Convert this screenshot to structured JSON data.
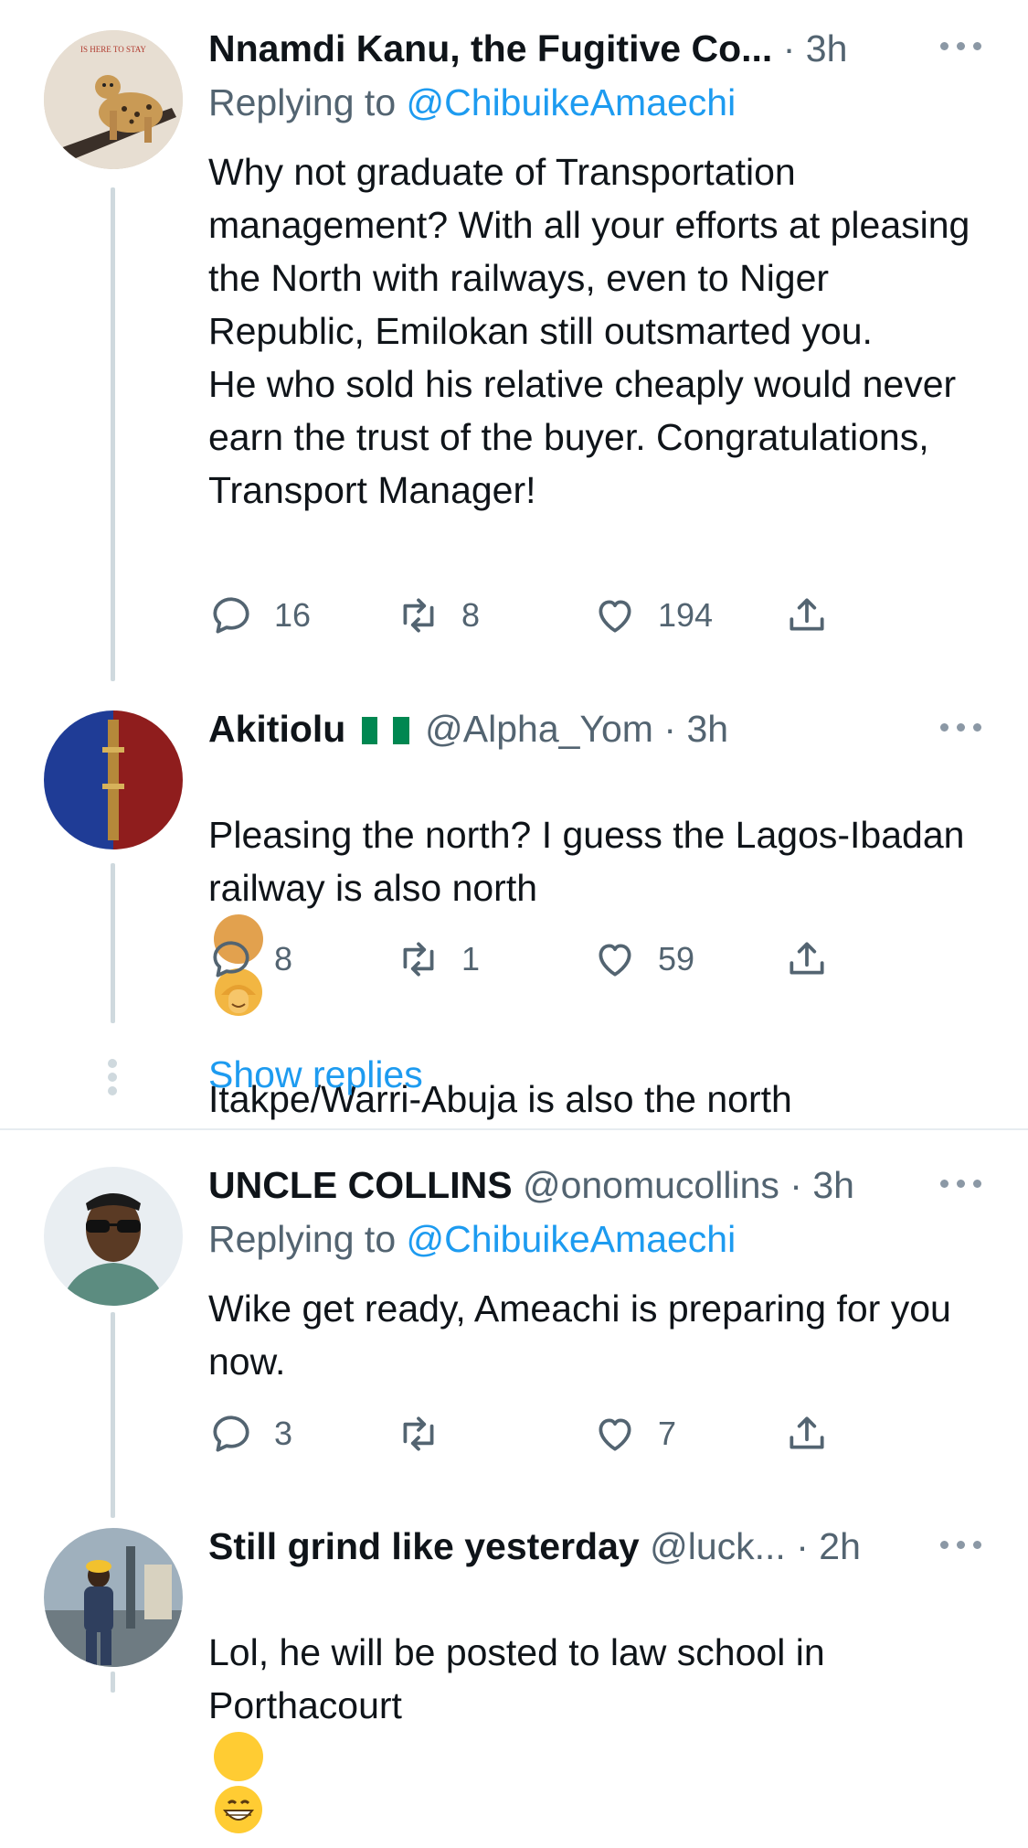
{
  "tweets": [
    {
      "name": "Nnamdi Kanu, the Fugitive Co...",
      "time": "3h",
      "replying_prefix": "Replying to",
      "replying_to": "@ChibuikeAmaechi",
      "avatar_icon": "cheetah-avatar",
      "avatar_text": "IS HERE TO STAY",
      "text": "Why not graduate of Transportation management? With all your efforts at pleasing the North with railways, even to Niger Republic,  Emilokan still outsmarted you.\nHe who sold his relative cheaply would never earn the trust of the buyer. Congratulations, Transport Manager!",
      "replies": "16",
      "retweets": "8",
      "likes": "194"
    },
    {
      "name": "Akitiolu",
      "flag_icon": "nigeria-flag-icon",
      "handle": "@Alpha_Yom",
      "time": "3h",
      "text_line1": "Pleasing the north? I guess the Lagos-Ibadan railway  is also north",
      "emoji_icon": "woman-facepalming-emoji",
      "text_line2": "Itakpe/Warri-Abuja is also the north",
      "replies": "8",
      "retweets": "1",
      "likes": "59"
    },
    {
      "name": "UNCLE COLLINS",
      "handle": "@onomucollins",
      "time": "3h",
      "replying_prefix": "Replying to",
      "replying_to": "@ChibuikeAmaechi",
      "text": "Wike get ready, Ameachi is preparing for you now.",
      "replies": "3",
      "retweets": "",
      "likes": "7"
    },
    {
      "name": "Still grind like yesterday",
      "handle": "@luck...",
      "time": "2h",
      "text": "Lol, he will be posted to law school in Porthacourt",
      "emoji_icon": "grinning-face-emoji"
    }
  ],
  "show_replies": "Show replies",
  "dot_separator": "·",
  "colors": {
    "link": "#1d9bf0",
    "secondary": "#536471",
    "thread_line": "#cfd9de",
    "flag_green": "#008751"
  }
}
